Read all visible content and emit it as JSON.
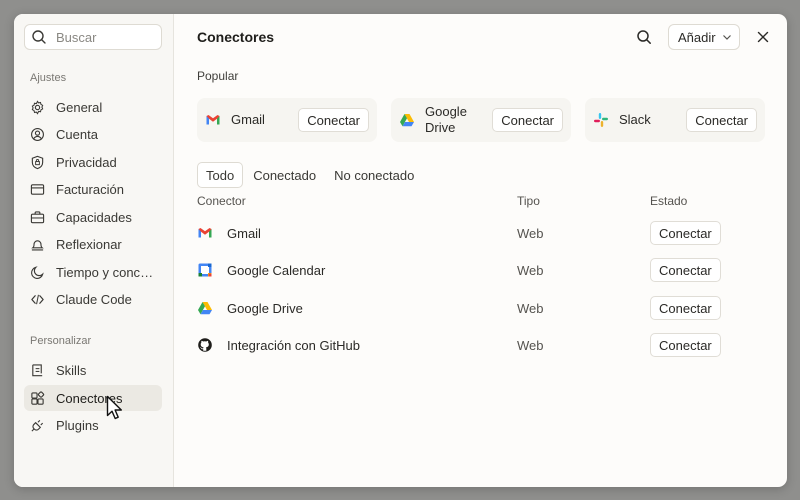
{
  "sidebar": {
    "search_placeholder": "Buscar",
    "section_settings": "Ajustes",
    "settings_items": [
      {
        "label": "General",
        "icon": "gear-icon"
      },
      {
        "label": "Cuenta",
        "icon": "user-circle-icon"
      },
      {
        "label": "Privacidad",
        "icon": "shield-icon"
      },
      {
        "label": "Facturación",
        "icon": "credit-card-icon"
      },
      {
        "label": "Capacidades",
        "icon": "briefcase-icon"
      },
      {
        "label": "Reflexionar",
        "icon": "bell-icon"
      },
      {
        "label": "Tiempo y conce…",
        "icon": "moon-icon"
      },
      {
        "label": "Claude Code",
        "icon": "code-icon"
      }
    ],
    "section_personalize": "Personalizar",
    "personalize_items": [
      {
        "label": "Skills",
        "icon": "skills-icon"
      },
      {
        "label": "Conectores",
        "icon": "connectors-icon"
      },
      {
        "label": "Plugins",
        "icon": "plug-icon"
      }
    ]
  },
  "main": {
    "title": "Conectores",
    "add_label": "Añadir",
    "popular_label": "Popular",
    "popular": [
      {
        "name": "Gmail",
        "button": "Conectar"
      },
      {
        "name": "Google Drive",
        "button": "Conectar"
      },
      {
        "name": "Slack",
        "button": "Conectar"
      }
    ],
    "tabs": [
      "Todo",
      "Conectado",
      "No conectado"
    ],
    "columns": [
      "Conector",
      "Tipo",
      "Estado"
    ],
    "rows": [
      {
        "name": "Gmail",
        "type": "Web",
        "button": "Conectar"
      },
      {
        "name": "Google Calendar",
        "type": "Web",
        "button": "Conectar"
      },
      {
        "name": "Google Drive",
        "type": "Web",
        "button": "Conectar"
      },
      {
        "name": "Integración con GitHub",
        "type": "Web",
        "button": "Conectar"
      }
    ]
  },
  "colors": {
    "gmail_red": "#ea4335",
    "google_blue": "#4285f4",
    "google_green": "#34a853",
    "google_yellow": "#fbbc04",
    "github_dark": "#1f1e1b"
  }
}
